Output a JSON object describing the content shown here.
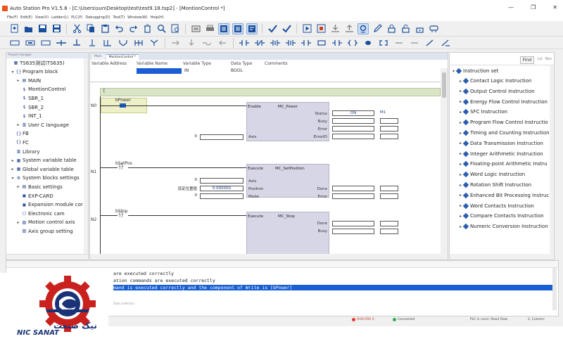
{
  "window": {
    "title": "Auto Station Pro V1.5.8 - [C:\\Users\\sun\\Desktop\\test\\test9.18.tsp2] - [MontionControl *]",
    "controls": [
      "—",
      "❐",
      "✕"
    ]
  },
  "menu": [
    "File(F)",
    "Edit(E)",
    "View(V)",
    "Ladder(L)",
    "PLC(P)",
    "Debugging(D)",
    "Tool(T)",
    "Window(W)",
    "Help(H)"
  ],
  "left_panel": {
    "header": "Project manager",
    "items": [
      {
        "label": "TS635测试(TS635)",
        "icon": "project-icon",
        "exp": ""
      },
      {
        "label": "Program block",
        "icon": "braces-icon",
        "exp": "▾"
      },
      {
        "label": "MAIN",
        "icon": "main-block-icon",
        "exp": "▸"
      },
      {
        "label": "MontionControl",
        "icon": "subroutine-icon",
        "exp": ""
      },
      {
        "label": "SBR_1",
        "icon": "subroutine-icon",
        "exp": ""
      },
      {
        "label": "SBR_2",
        "icon": "subroutine-icon",
        "exp": ""
      },
      {
        "label": "INT_1",
        "icon": "interrupt-icon",
        "exp": ""
      },
      {
        "label": "User C language",
        "icon": "c-language-icon",
        "exp": "▸"
      },
      {
        "label": "FB",
        "icon": "braces-icon",
        "exp": ""
      },
      {
        "label": "FC",
        "icon": "braces-icon",
        "exp": ""
      },
      {
        "label": "Library",
        "icon": "library-icon",
        "exp": ""
      },
      {
        "label": "System variable table",
        "icon": "table-icon",
        "exp": "▸"
      },
      {
        "label": "Global variable table",
        "icon": "table-icon",
        "exp": "▸"
      },
      {
        "label": "System blocks settings",
        "icon": "settings-icon",
        "exp": "▾"
      },
      {
        "label": "Basic settings",
        "icon": "folder-icon",
        "exp": "▸"
      },
      {
        "label": "EXP-CARD",
        "icon": "card-icon",
        "exp": ""
      },
      {
        "label": "Expansion module cor",
        "icon": "module-icon",
        "exp": ""
      },
      {
        "label": "Electronic cam",
        "icon": "cam-icon",
        "exp": ""
      },
      {
        "label": "Motion control axis",
        "icon": "axis-icon",
        "exp": "▸"
      },
      {
        "label": "Axis group setting",
        "icon": "axis-group-icon",
        "exp": ""
      }
    ]
  },
  "editor": {
    "tabs": [
      "Main",
      "MontionControl *"
    ],
    "var_headers": [
      "Variable Address",
      "Variable Name",
      "Variable Type",
      "Data Type",
      "Comments"
    ],
    "var_row": {
      "type": "IN",
      "dtype": "BOOL"
    },
    "bar_text": "[",
    "networks": [
      {
        "id": "N0",
        "contact": "bPower",
        "fb_pin_in": "Enable",
        "fb_name": "MC_Power",
        "outputs": [
          {
            "pin": "Status",
            "value": "ON",
            "extra": "M1"
          },
          {
            "pin": "Busy",
            "value": "",
            "extra": ""
          },
          {
            "pin": "Error",
            "value": "",
            "extra": ""
          },
          {
            "pin": "ErrorID",
            "value": "",
            "extra": ""
          }
        ],
        "inputs": [
          {
            "pin": "Axis",
            "value": "0"
          }
        ]
      },
      {
        "id": "N1",
        "contact": "bSetPos",
        "fb_pin_in": "Execute",
        "fb_name": "MC_SetPosition",
        "inputs": [
          {
            "pin": "Axis",
            "value": "0",
            "label": ""
          },
          {
            "pin": "Position",
            "value": "0.000000",
            "label": "设定位置值"
          },
          {
            "pin": "Mode",
            "value": "0",
            "label": ""
          }
        ],
        "outputs": [
          {
            "pin": "Done"
          },
          {
            "pin": "Error"
          }
        ]
      },
      {
        "id": "N2",
        "contact": "bStop",
        "fb_pin_in": "Execute",
        "fb_name": "MC_Stop",
        "outputs": [
          {
            "pin": "Done"
          },
          {
            "pin": "Busy"
          }
        ]
      }
    ]
  },
  "right_panel": {
    "find_label": "Find",
    "buttons": [
      "Lst",
      "Rev"
    ],
    "header": "Instruction set",
    "items": [
      "Contact Logic Instruction",
      "Output Control Instruction",
      "Energy Flow Control Instruction",
      "SFC Instruction",
      "Program Flow Control Instructio",
      "Timing and Counting Instruction",
      "Data Transmission Instruction",
      "Integer Arithmetic Instruction",
      "Floating-point Arithmetic Instru",
      "Word Logic Instruction",
      "Rotation Shift Instruction",
      "Enhanced Bit Processing Instruc",
      "Word Contacts Instruction",
      "Compare Contacts Instruction",
      "Numeric Conversion Instruction"
    ]
  },
  "output": {
    "lines": [
      "are executed correctly",
      "ation commands are executed correctly",
      "mand is executed correctly and the component of Write is [bPower]"
    ],
    "footer": "Data collection"
  },
  "status": {
    "run": "RUN ERR 0",
    "conn": "Connected",
    "plc": "PLC is runni: Row1 Row:",
    "col": "2, Column:"
  },
  "logo": {
    "en": "NIC SANAT",
    "fa": "نیک صنعت",
    "colors": {
      "red": "#c9211e",
      "blue": "#1a3277"
    }
  },
  "colors": {
    "selection": "#1a5ed4",
    "diamond": "#2a5db0",
    "fb_fill": "#d6d6e6"
  }
}
